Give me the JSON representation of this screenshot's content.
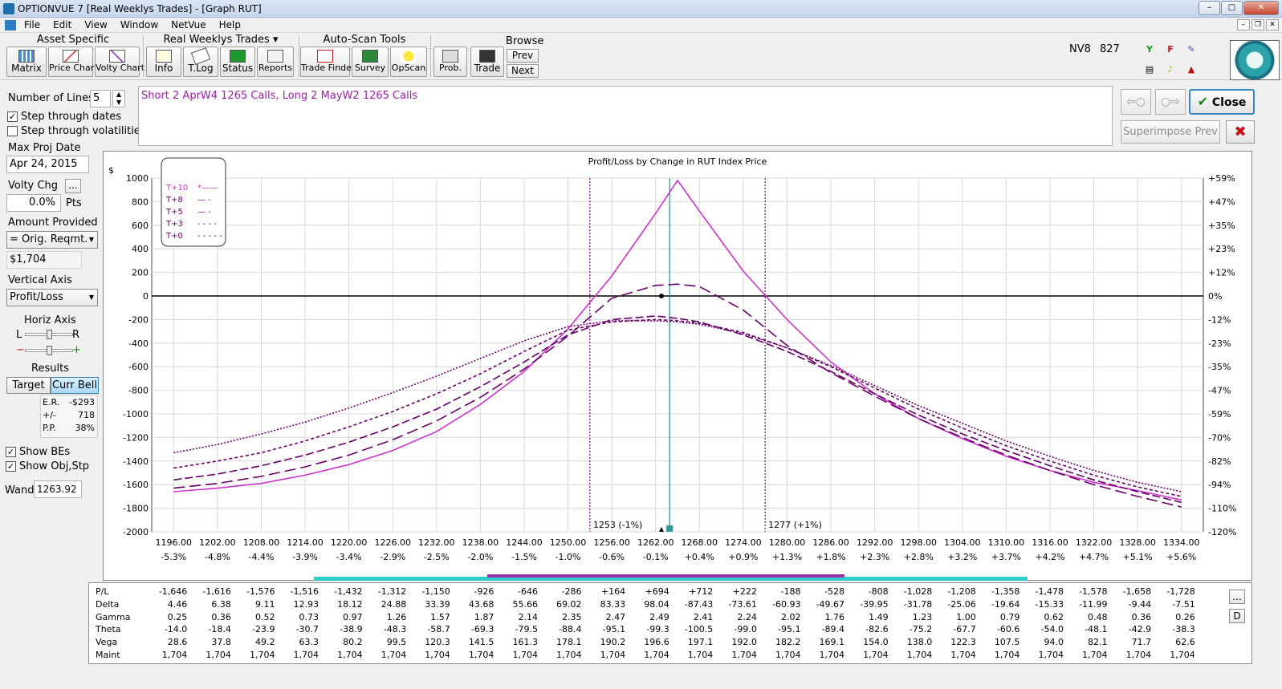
{
  "window": {
    "title": "OPTIONVUE 7  [Real Weeklys Trades] - [Graph RUT]",
    "min": "–",
    "restore": "□",
    "close": "✕"
  },
  "menu": [
    "File",
    "Edit",
    "View",
    "Window",
    "NetVue",
    "Help"
  ],
  "toolbar": {
    "asset_specific": {
      "title": "Asset Specific",
      "buttons": [
        "Matrix",
        "Price Chart",
        "Volty Chart"
      ]
    },
    "real_weeklys": {
      "title": "Real Weeklys Trades ▾",
      "buttons": [
        "Info",
        "T.Log",
        "Status",
        "Reports"
      ]
    },
    "auto_scan": {
      "title": "Auto-Scan Tools",
      "buttons": [
        "Trade Finder",
        "Survey",
        "OpScan"
      ]
    },
    "misc_buttons": [
      "Prob.",
      "Trade"
    ],
    "browse": {
      "title": "Browse",
      "prev": "Prev",
      "next": "Next"
    },
    "nv8_label": "NV8",
    "nv8_value": "827"
  },
  "left_panel": {
    "number_of_lines_label": "Number of Lines",
    "number_of_lines_value": "5",
    "step_dates_label": "Step through dates",
    "step_dates_checked": true,
    "step_vols_label": "Step through volatilities",
    "step_vols_checked": false,
    "max_proj_date_label": "Max Proj Date",
    "max_proj_date_value": "Apr 24, 2015",
    "volty_chg_label": "Volty Chg",
    "volty_chg_button": "...",
    "volty_chg_value": "0.0%",
    "volty_chg_unit": "Pts",
    "amount_provided_label": "Amount Provided",
    "amount_provided_select": "= Orig. Reqmt.",
    "amount_value": "$1,704",
    "vertical_axis_label": "Vertical Axis",
    "vertical_axis_select": "Profit/Loss",
    "horiz_axis_label": "Horiz Axis",
    "horiz_l": "L",
    "horiz_r": "R",
    "minus": "−",
    "plus": "+",
    "results_label": "Results",
    "target_btn": "Target",
    "curr_bell_btn": "Curr Bell",
    "er_label": "E.R.",
    "er_value": "-$293",
    "pm_label": "+/-",
    "pm_value": "718",
    "pp_label": "P.P.",
    "pp_value": "38%",
    "show_bes_label": "Show BEs",
    "show_bes_checked": true,
    "show_objstp_label": "Show Obj,Stp",
    "show_objstp_checked": true,
    "wand_label": "Wand",
    "wand_value": "1263.92"
  },
  "description": "Short 2 AprW4 1265 Calls, Long 2 MayW2 1265 Calls",
  "buttons": {
    "back_arrow": "⇦○",
    "fwd_arrow": "○⇨",
    "close": "Close",
    "close_check": "✔",
    "superimpose": "Superimpose Prev",
    "x": "✖"
  },
  "chart_data": {
    "type": "line",
    "title": "Profit/Loss by Change in RUT Index Price",
    "ylabel": "$",
    "xlim": [
      1193,
      1337
    ],
    "ylim": [
      -2000,
      1000
    ],
    "yticks": [
      1000,
      800,
      600,
      400,
      200,
      0,
      -200,
      -400,
      -600,
      -800,
      -1000,
      -1200,
      -1400,
      -1600,
      -1800,
      -2000
    ],
    "right_ticks": [
      "+59%",
      "+47%",
      "+35%",
      "+23%",
      "+12%",
      "0%",
      "-12%",
      "-23%",
      "-35%",
      "-47%",
      "-59%",
      "-70%",
      "-82%",
      "-94%",
      "-110%",
      "-120%"
    ],
    "xticks": [
      1196,
      1202,
      1208,
      1214,
      1220,
      1226,
      1232,
      1238,
      1244,
      1250,
      1256,
      1262,
      1268,
      1274,
      1280,
      1286,
      1292,
      1298,
      1304,
      1310,
      1316,
      1322,
      1328,
      1334
    ],
    "xtick_labels": [
      "1196.00",
      "1202.00",
      "1208.00",
      "1214.00",
      "1220.00",
      "1226.00",
      "1232.00",
      "1238.00",
      "1244.00",
      "1250.00",
      "1256.00",
      "1262.00",
      "1268.00",
      "1274.00",
      "1280.00",
      "1286.00",
      "1292.00",
      "1298.00",
      "1304.00",
      "1310.00",
      "1316.00",
      "1322.00",
      "1328.00",
      "1334.00"
    ],
    "xtick_pct": [
      "-5.3%",
      "-4.8%",
      "-4.4%",
      "-3.9%",
      "-3.4%",
      "-2.9%",
      "-2.5%",
      "-2.0%",
      "-1.5%",
      "-1.0%",
      "-0.6%",
      "-0.1%",
      "+0.4%",
      "+0.9%",
      "+1.3%",
      "+1.8%",
      "+2.3%",
      "+2.8%",
      "+3.2%",
      "+3.7%",
      "+4.2%",
      "+4.7%",
      "+5.1%",
      "+5.6%"
    ],
    "grid": true,
    "legend_position": "top-left",
    "x": [
      1196,
      1202,
      1208,
      1214,
      1220,
      1226,
      1232,
      1238,
      1244,
      1250,
      1256,
      1262,
      1265,
      1268,
      1274,
      1280,
      1286,
      1292,
      1298,
      1304,
      1310,
      1316,
      1322,
      1328,
      1334
    ],
    "series": [
      {
        "name": "T+10",
        "color": "#cc33cc",
        "dash": "",
        "values": [
          -1660,
          -1630,
          -1590,
          -1520,
          -1430,
          -1310,
          -1150,
          -920,
          -640,
          -280,
          170,
          700,
          980,
          720,
          210,
          -200,
          -560,
          -830,
          -1040,
          -1210,
          -1360,
          -1480,
          -1580,
          -1650,
          -1730
        ]
      },
      {
        "name": "T+8",
        "color": "#660066",
        "dash": "14,6",
        "values": [
          -1630,
          -1590,
          -1530,
          -1450,
          -1350,
          -1220,
          -1060,
          -860,
          -620,
          -340,
          -20,
          90,
          100,
          80,
          -120,
          -420,
          -650,
          -850,
          -1040,
          -1200,
          -1350,
          -1480,
          -1600,
          -1700,
          -1790
        ]
      },
      {
        "name": "T+5",
        "color": "#660066",
        "dash": "10,4",
        "values": [
          -1560,
          -1510,
          -1440,
          -1350,
          -1240,
          -1110,
          -960,
          -770,
          -560,
          -330,
          -200,
          -170,
          -190,
          -220,
          -330,
          -470,
          -640,
          -830,
          -1010,
          -1170,
          -1310,
          -1440,
          -1560,
          -1660,
          -1750
        ]
      },
      {
        "name": "T+3",
        "color": "#660066",
        "dash": "4,3",
        "values": [
          -1460,
          -1400,
          -1330,
          -1230,
          -1110,
          -980,
          -830,
          -660,
          -470,
          -290,
          -220,
          -200,
          -210,
          -230,
          -310,
          -440,
          -600,
          -780,
          -960,
          -1120,
          -1270,
          -1400,
          -1520,
          -1620,
          -1700
        ]
      },
      {
        "name": "T+0",
        "color": "#660066",
        "dash": "2,2",
        "values": [
          -1330,
          -1260,
          -1170,
          -1070,
          -950,
          -820,
          -680,
          -530,
          -380,
          -260,
          -210,
          -210,
          -220,
          -240,
          -320,
          -440,
          -590,
          -760,
          -930,
          -1080,
          -1230,
          -1360,
          -1480,
          -1580,
          -1660
        ]
      }
    ],
    "legend_samples": [
      "*——",
      "— -",
      "— -",
      "- - - -",
      "- - - - -"
    ],
    "breakevens": [
      {
        "x": 1253,
        "label": "1253 (-1%)"
      },
      {
        "x": 1277,
        "label": "1277 (+1%)"
      }
    ],
    "wand_x": 1263.92,
    "current_point": {
      "x": 1262.8,
      "y": 0
    }
  },
  "table": {
    "rows": [
      {
        "label": "P/L",
        "values": [
          "-1,646",
          "-1,616",
          "-1,576",
          "-1,516",
          "-1,432",
          "-1,312",
          "-1,150",
          "-926",
          "-646",
          "-286",
          "+164",
          "+694",
          "+712",
          "+222",
          "-188",
          "-528",
          "-808",
          "-1,028",
          "-1,208",
          "-1,358",
          "-1,478",
          "-1,578",
          "-1,658",
          "-1,728"
        ]
      },
      {
        "label": "Delta",
        "values": [
          "4.46",
          "6.38",
          "9.11",
          "12.93",
          "18.12",
          "24.88",
          "33.39",
          "43.68",
          "55.66",
          "69.02",
          "83.33",
          "98.04",
          "-87.43",
          "-73.61",
          "-60.93",
          "-49.67",
          "-39.95",
          "-31.78",
          "-25.06",
          "-19.64",
          "-15.33",
          "-11.99",
          "-9.44",
          "-7.51"
        ]
      },
      {
        "label": "Gamma",
        "values": [
          "0.25",
          "0.36",
          "0.52",
          "0.73",
          "0.97",
          "1.26",
          "1.57",
          "1.87",
          "2.14",
          "2.35",
          "2.47",
          "2.49",
          "2.41",
          "2.24",
          "2.02",
          "1.76",
          "1.49",
          "1.23",
          "1.00",
          "0.79",
          "0.62",
          "0.48",
          "0.36",
          "0.26"
        ]
      },
      {
        "label": "Theta",
        "values": [
          "-14.0",
          "-18.4",
          "-23.9",
          "-30.7",
          "-38.9",
          "-48.3",
          "-58.7",
          "-69.3",
          "-79.5",
          "-88.4",
          "-95.1",
          "-99.3",
          "-100.5",
          "-99.0",
          "-95.1",
          "-89.4",
          "-82.6",
          "-75.2",
          "-67.7",
          "-60.6",
          "-54.0",
          "-48.1",
          "-42.9",
          "-38.3"
        ]
      },
      {
        "label": "Vega",
        "values": [
          "28.6",
          "37.8",
          "49.2",
          "63.3",
          "80.2",
          "99.5",
          "120.3",
          "141.5",
          "161.3",
          "178.1",
          "190.2",
          "196.6",
          "197.1",
          "192.0",
          "182.2",
          "169.1",
          "154.0",
          "138.0",
          "122.3",
          "107.5",
          "94.0",
          "82.1",
          "71.7",
          "62.6"
        ]
      },
      {
        "label": "Maint",
        "values": [
          "1,704",
          "1,704",
          "1,704",
          "1,704",
          "1,704",
          "1,704",
          "1,704",
          "1,704",
          "1,704",
          "1,704",
          "1,704",
          "1,704",
          "1,704",
          "1,704",
          "1,704",
          "1,704",
          "1,704",
          "1,704",
          "1,704",
          "1,704",
          "1,704",
          "1,704",
          "1,704",
          "1,704"
        ]
      }
    ],
    "side_btn1": "...",
    "side_btn2": "D"
  },
  "range_bar": {
    "outer_range": [
      1253,
      1277
    ],
    "outer_color": "#33cccc",
    "inner_range": [
      1257,
      1271
    ],
    "inner_color": "#9933aa"
  }
}
